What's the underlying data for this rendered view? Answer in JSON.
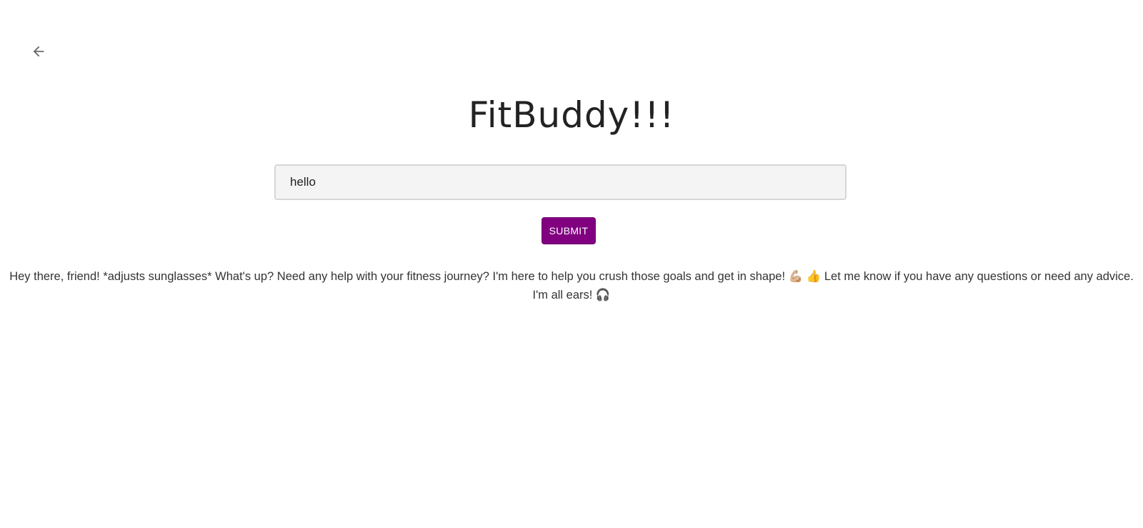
{
  "header": {
    "back_icon": "arrow-left-icon"
  },
  "app": {
    "title": "FitBuddy!!!"
  },
  "prompt": {
    "value": "hello",
    "placeholder": ""
  },
  "actions": {
    "submit_label": "SUBMIT"
  },
  "response": {
    "text": "Hey there, friend! *adjusts sunglasses* What's up? Need any help with your fitness journey? I'm here to help you crush those goals and get in shape! 💪🏼 👍 Let me know if you have any questions or need any advice. I'm all ears! 🎧"
  },
  "colors": {
    "accent": "#800080",
    "input_bg": "#f4f4f4",
    "text": "#333333"
  }
}
